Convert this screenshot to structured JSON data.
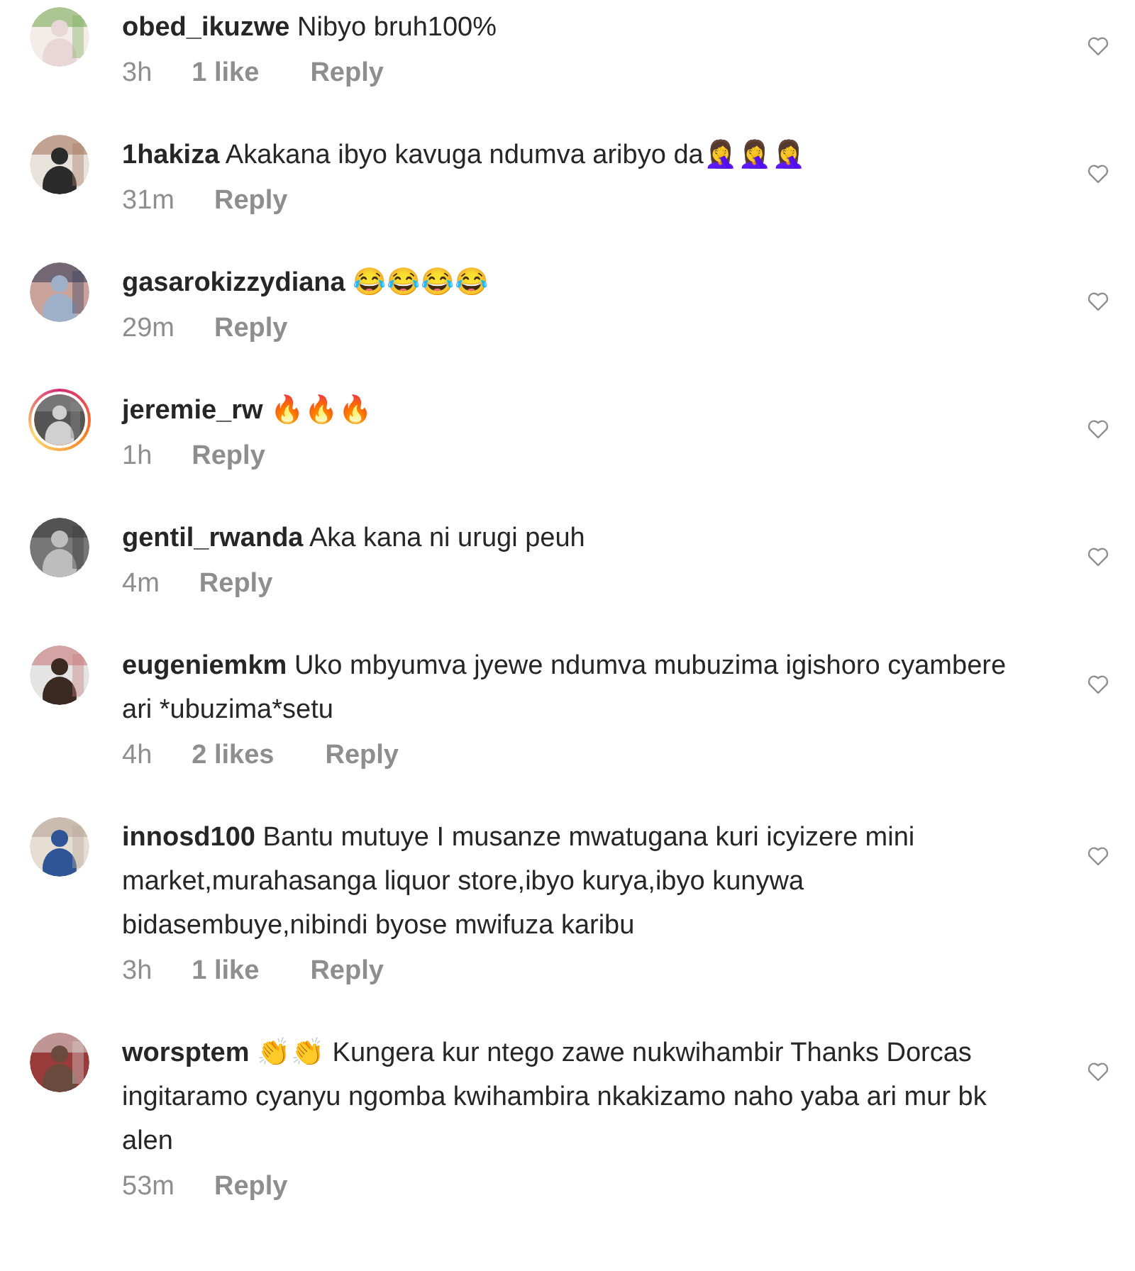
{
  "comments": [
    {
      "username": "obed_ikuzwe",
      "text": "Nibyo bruh100%",
      "time": "3h",
      "likes": "1 like",
      "reply": "Reply",
      "story": false
    },
    {
      "username": "1hakiza",
      "text": "Akakana ibyo kavuga ndumva aribyo da🤦‍♀️🤦‍♀️🤦‍♀️",
      "time": "31m",
      "reply": "Reply",
      "story": false
    },
    {
      "username": "gasarokizzydiana",
      "text": "😂😂😂😂",
      "time": "29m",
      "reply": "Reply",
      "story": false
    },
    {
      "username": "jeremie_rw",
      "text": "🔥🔥🔥",
      "time": "1h",
      "reply": "Reply",
      "story": true
    },
    {
      "username": "gentil_rwanda",
      "text": "Aka kana ni urugi peuh",
      "time": "4m",
      "reply": "Reply",
      "story": false
    },
    {
      "username": "eugeniemkm",
      "text": "Uko mbyumva jyewe ndumva mubuzima igishoro cyambere ari *ubuzima*setu",
      "time": "4h",
      "likes": "2 likes",
      "reply": "Reply",
      "story": false
    },
    {
      "username": "innosd100",
      "text": "Bantu mutuye I musanze mwatugana kuri icyizere mini market,murahasanga liquor store,ibyo kurya,ibyo kunywa bidasembuye,nibindi byose mwifuza karibu",
      "time": "3h",
      "likes": "1 like",
      "reply": "Reply",
      "story": false
    },
    {
      "username": "worsptem",
      "text": "👏👏 Kungera kur ntego zawe nukwihambir Thanks Dorcas ingitaramo cyanyu ngomba kwihambira nkakizamo naho yaba ari mur bk alen",
      "time": "53m",
      "reply": "Reply",
      "story": false
    }
  ]
}
